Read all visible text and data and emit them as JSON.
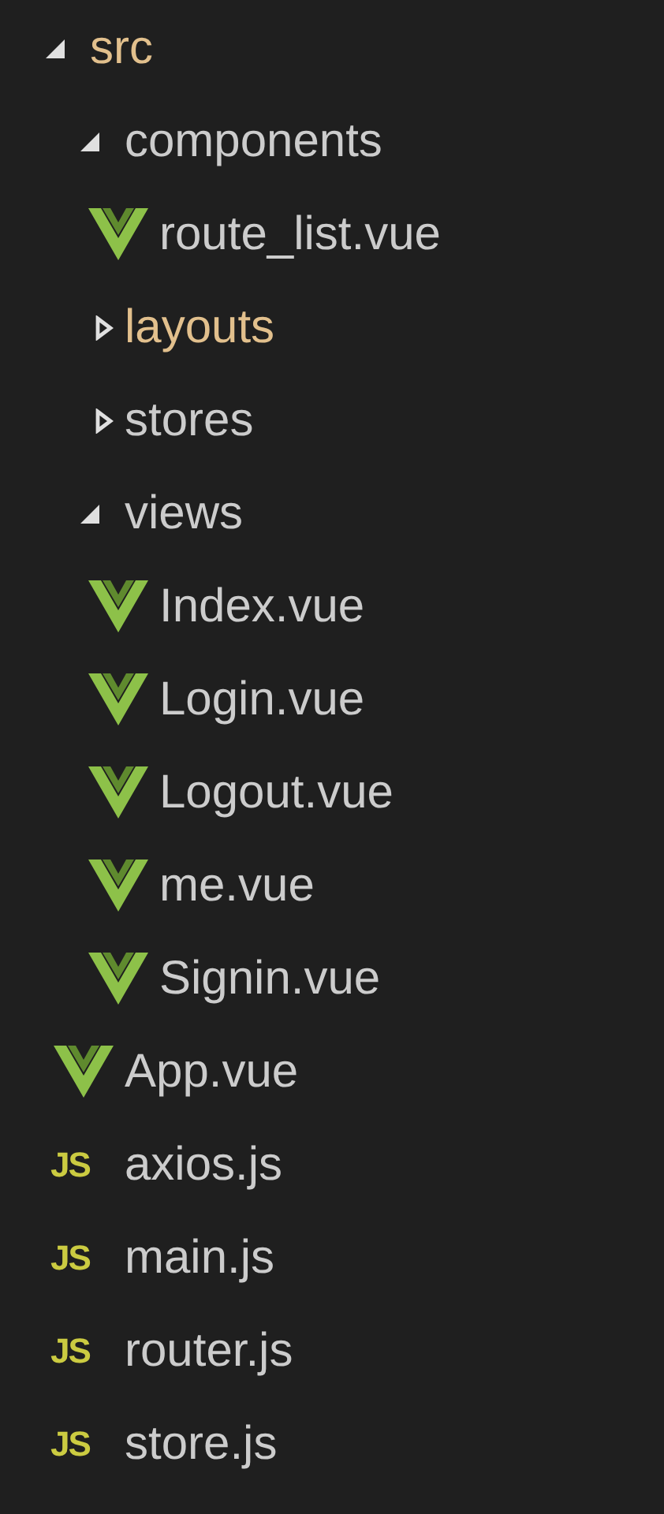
{
  "tree": [
    {
      "kind": "folder",
      "name": "src",
      "expanded": true,
      "color": "#e2c08d",
      "children": [
        {
          "kind": "folder",
          "name": "components",
          "expanded": true,
          "color": "#cccccc",
          "children": [
            {
              "kind": "vue",
              "name": "route_list.vue",
              "color": "#cccccc"
            }
          ]
        },
        {
          "kind": "folder",
          "name": "layouts",
          "expanded": false,
          "color": "#e2c08d"
        },
        {
          "kind": "folder",
          "name": "stores",
          "expanded": false,
          "color": "#cccccc"
        },
        {
          "kind": "folder",
          "name": "views",
          "expanded": true,
          "color": "#cccccc",
          "children": [
            {
              "kind": "vue",
              "name": "Index.vue",
              "color": "#cccccc"
            },
            {
              "kind": "vue",
              "name": "Login.vue",
              "color": "#cccccc"
            },
            {
              "kind": "vue",
              "name": "Logout.vue",
              "color": "#cccccc"
            },
            {
              "kind": "vue",
              "name": "me.vue",
              "color": "#cccccc"
            },
            {
              "kind": "vue",
              "name": "Signin.vue",
              "color": "#cccccc"
            }
          ]
        },
        {
          "kind": "vue",
          "name": "App.vue",
          "color": "#cccccc"
        },
        {
          "kind": "js",
          "icon_text": "JS",
          "name": "axios.js",
          "color": "#cccccc"
        },
        {
          "kind": "js",
          "icon_text": "JS",
          "name": "main.js",
          "color": "#cccccc"
        },
        {
          "kind": "js",
          "icon_text": "JS",
          "name": "router.js",
          "color": "#cccccc"
        },
        {
          "kind": "js",
          "icon_text": "JS",
          "name": "store.js",
          "color": "#cccccc"
        }
      ]
    }
  ]
}
